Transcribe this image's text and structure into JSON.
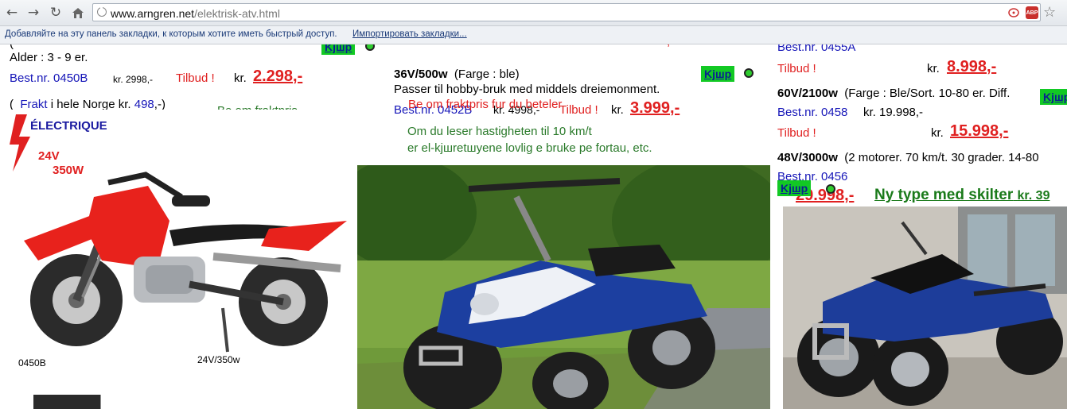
{
  "browser": {
    "url_host": "www.arngren.net",
    "url_path": "/elektrisk-atv.html",
    "bookmarks_text": "Добавляйте на эту панель закладки, к которым хотите иметь быстрый доступ.",
    "bookmarks_link": "Импортировать закладки...",
    "abp_label": "ABP",
    "icons": [
      "back-icon",
      "forward-icon",
      "reload-icon",
      "home-icon",
      "page-icon",
      "rss-icon",
      "adblock-icon",
      "star-icon"
    ]
  },
  "left": {
    "top_cut": "(  ",
    "age": "Alder : 3 - 9 er.",
    "best_nr": "Best.nr. 0450B",
    "old_price": "kr. 2998,-",
    "tilbud": "Tilbud !",
    "kr": "kr.",
    "price": "2.298,-",
    "frakt_open": "(",
    "frakt_link": "Frakt",
    "frakt_text": "i hele Norge kr.",
    "frakt_price": "498",
    "frakt_close": ",-)",
    "ask_freight": "Be om fraktpris",
    "bike_label": "0450B",
    "bike_spec": "24V/350w",
    "badge_title": "ÉLECTRIQUE",
    "badge_volt": "24V",
    "badge_watt": "350W"
  },
  "middle": {
    "top_cut_price": ",-",
    "model": "36V/500w",
    "color": "(Farge : ble)",
    "desc": "Passer til hobby-bruk med middels dreiemonment.",
    "ask_freight_overlay": "Be om fraktpris fur du beteler",
    "best_nr": "Best.nr. 0452B",
    "old_price": "kr. 4998,-",
    "tilbud": "Tilbud !",
    "kr": "kr.",
    "price": "3.999,-",
    "info_1": "Om du leser hastigheten til 10 km/t",
    "info_2": "er el-kjшretшyene lovlig e bruke pe fortau, etc.",
    "buy": "Kjшp"
  },
  "top_buy": "Kjшp",
  "right": {
    "best_nr_cut": "Best.nr. 0455A",
    "tilbud_1": "Tilbud !",
    "kr_1": "kr.",
    "price_1": "8.998,-",
    "model_2": "60V/2100w",
    "desc_2": "(Farge : Ble/Sort. 10-80 er. Diff.",
    "buy_2": "Kjшp",
    "best_nr_2": "Best.nr. 0458",
    "old_price_2": "kr. 19.998,-",
    "tilbud_2": "Tilbud !",
    "kr_2": "kr.",
    "price_2": "15.998,-",
    "model_3": "48V/3000w",
    "desc_3": "(2 motorer. 70 km/t. 30 grader. 14-80",
    "best_nr_3": "Best.nr. 0456",
    "buy_3": "Kjшp",
    "price_3": "29.998,-",
    "new_type": "Ny type med skilter",
    "new_type_kr": "kr. 39"
  }
}
